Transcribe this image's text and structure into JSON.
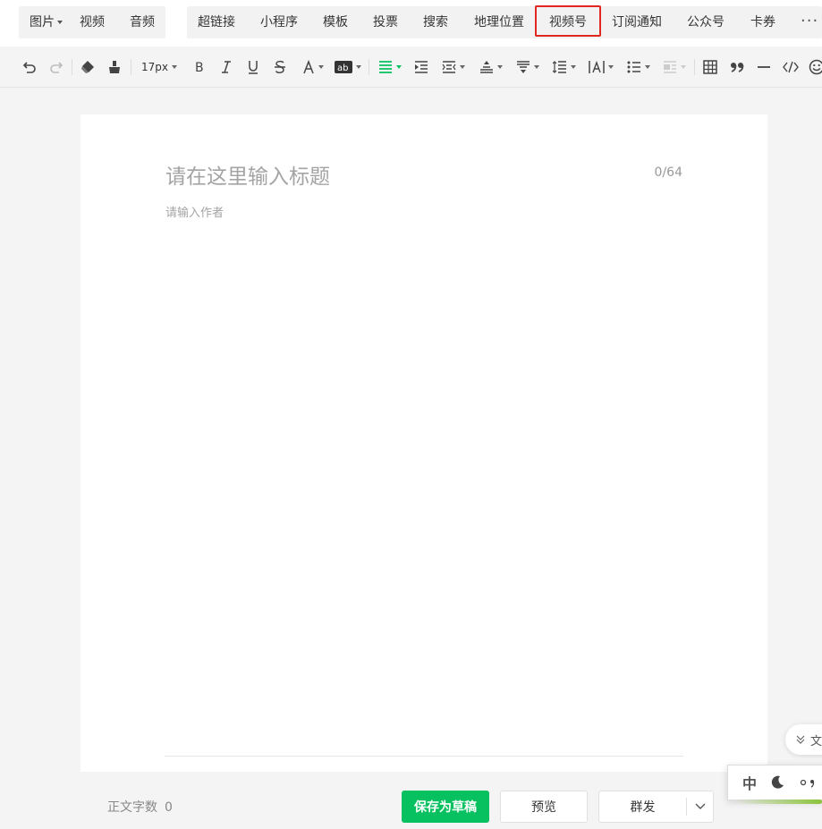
{
  "insert_bar": {
    "group1": [
      {
        "label": "图片",
        "has_dropdown": true
      },
      {
        "label": "视频",
        "has_dropdown": false
      },
      {
        "label": "音频",
        "has_dropdown": false
      }
    ],
    "group2": [
      {
        "label": "超链接"
      },
      {
        "label": "小程序"
      },
      {
        "label": "模板"
      },
      {
        "label": "投票"
      },
      {
        "label": "搜索"
      },
      {
        "label": "地理位置"
      },
      {
        "label": "视频号",
        "highlighted": true
      },
      {
        "label": "订阅通知"
      },
      {
        "label": "公众号"
      },
      {
        "label": "卡券"
      }
    ],
    "more_icon": "more-dots-icon",
    "highlight_color": "#e0261f"
  },
  "toolbar": {
    "font_size": "17px",
    "accent_color": "#07c160",
    "icons": [
      "undo-icon",
      "redo-icon",
      "format-painter-icon",
      "clear-format-icon",
      "bold-icon",
      "italic-icon",
      "underline-icon",
      "strikethrough-icon",
      "font-color-icon",
      "background-color-icon",
      "align-icon",
      "indent-icon",
      "first-line-indent-icon",
      "paragraph-spacing-before-icon",
      "paragraph-spacing-after-icon",
      "line-height-icon",
      "letter-spacing-icon",
      "list-icon",
      "image-float-icon",
      "table-icon",
      "quote-icon",
      "divider-icon",
      "code-icon",
      "emoji-icon"
    ]
  },
  "editor": {
    "title_placeholder": "请在这里输入标题",
    "title_count": "0/64",
    "author_placeholder": "请输入作者"
  },
  "footer": {
    "word_count_label": "正文字数",
    "word_count_value": "0",
    "save_label": "保存为草稿",
    "preview_label": "预览",
    "publish_label": "群发",
    "save_color": "#07c160"
  },
  "floating": {
    "doc_label": "文",
    "ime_lang": "中"
  }
}
